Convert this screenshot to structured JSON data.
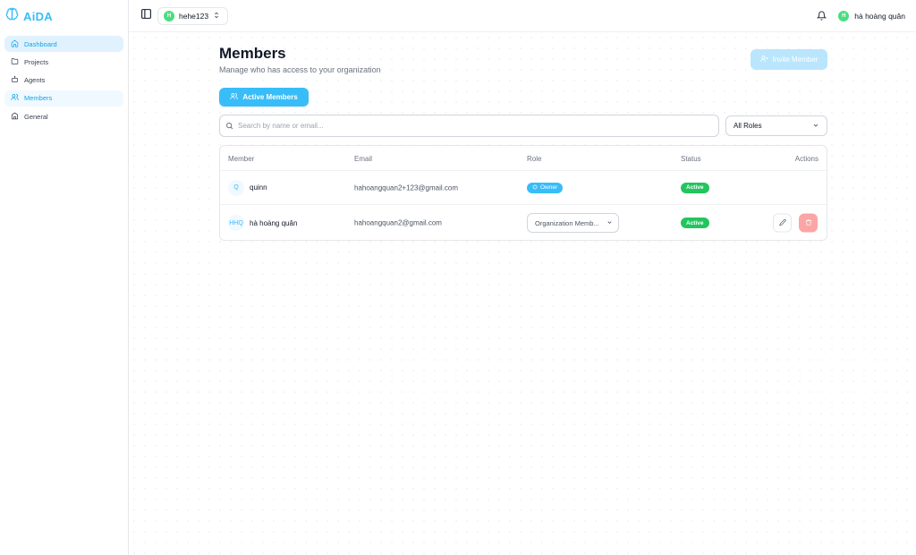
{
  "brand": {
    "name": "AiDA"
  },
  "sidebar": {
    "items": [
      {
        "label": "Dashboard",
        "icon": "home-icon"
      },
      {
        "label": "Projects",
        "icon": "folder-icon"
      },
      {
        "label": "Agents",
        "icon": "bot-icon"
      },
      {
        "label": "Members",
        "icon": "users-icon"
      },
      {
        "label": "General",
        "icon": "building-icon"
      }
    ]
  },
  "header": {
    "org": {
      "avatar": "H",
      "name": "hehe123"
    },
    "user": {
      "avatar": "H",
      "name": "hà hoàng quân"
    }
  },
  "page": {
    "title": "Members",
    "subtitle": "Manage who has access to your organization",
    "invite_label": "Invite Member",
    "tab_label": "Active Members"
  },
  "search": {
    "placeholder": "Search by name or email..."
  },
  "filter": {
    "value": "All Roles"
  },
  "table": {
    "columns": [
      "Member",
      "Email",
      "Role",
      "Status",
      "Actions"
    ],
    "rows": [
      {
        "initials": "Q",
        "name": "quinn",
        "email": "hahoangquan2+123@gmail.com",
        "role": "Owner",
        "status": "Active"
      },
      {
        "initials": "HHQ",
        "name": "hà hoàng quân",
        "email": "hahoangquan2@gmail.com",
        "role": "Organization Memb...",
        "status": "Active"
      }
    ]
  },
  "colors": {
    "accent": "#38bdf8",
    "accent_light": "#e0f2fe",
    "status_active": "#22c55e",
    "danger_light": "#fca5a5",
    "avatar_green": "#4ade80"
  }
}
